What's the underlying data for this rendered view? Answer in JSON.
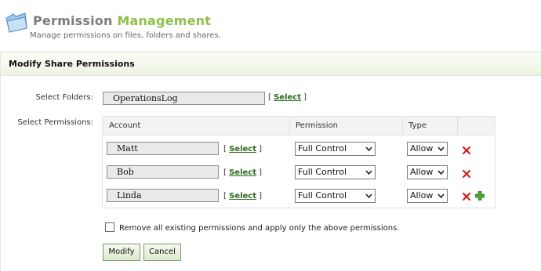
{
  "header": {
    "title_part1": "Permission",
    "title_part2": "Management",
    "subtitle": "Manage permissions on files, folders and shares."
  },
  "panel": {
    "title": "Modify Share Permissions"
  },
  "folders": {
    "label": "Select Folders:",
    "value": "OperationsLog",
    "select_link": "Select"
  },
  "permissions": {
    "label": "Select Permissions:",
    "columns": {
      "account": "Account",
      "permission": "Permission",
      "type": "Type"
    },
    "rows": [
      {
        "account": "Matt",
        "select_link": "Select",
        "permission": "Full Control",
        "type": "Allow"
      },
      {
        "account": "Bob",
        "select_link": "Select",
        "permission": "Full Control",
        "type": "Allow"
      },
      {
        "account": "Linda",
        "select_link": "Select",
        "permission": "Full Control",
        "type": "Allow"
      }
    ]
  },
  "options": {
    "remove_existing_label": "Remove all existing permissions and apply only the above permissions.",
    "remove_existing_checked": false
  },
  "buttons": {
    "modify": "Modify",
    "cancel": "Cancel"
  },
  "icons": {
    "header": "folder-icon",
    "remove_row": "red-x-icon",
    "add_row": "green-plus-icon"
  },
  "colors": {
    "title_gray": "#7d7d7d",
    "title_green": "#8fc04a",
    "link_green": "#2f6a1e",
    "remove_red": "#d42020",
    "add_green": "#4aa52e"
  }
}
